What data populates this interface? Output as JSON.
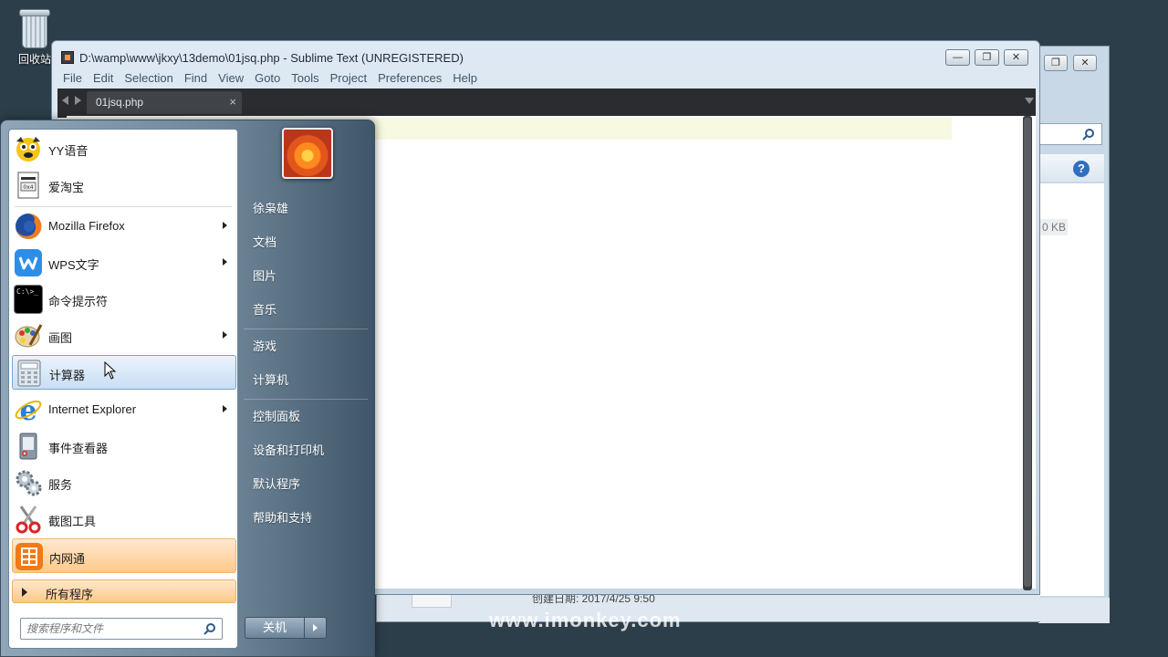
{
  "desktop": {
    "recycle_bin_label": "回收站"
  },
  "explorer": {
    "size_text": "0 KB",
    "created_text": "创建日期: 2017/4/25 9:50",
    "minimize": "▭",
    "close": "✕",
    "help": "?"
  },
  "watermark": "www.imonkey.com",
  "sublime": {
    "title": "D:\\wamp\\www\\jkxy\\13demo\\01jsq.php - Sublime Text (UNREGISTERED)",
    "controls": {
      "minimize": "—",
      "maximize": "❐",
      "close": "✕"
    },
    "menu": [
      "File",
      "Edit",
      "Selection",
      "Find",
      "View",
      "Goto",
      "Tools",
      "Project",
      "Preferences",
      "Help"
    ],
    "tab": {
      "label": "01jsq.php",
      "close": "×"
    }
  },
  "start_menu": {
    "programs": [
      {
        "name": "YY语音",
        "icon": "yy-icon",
        "arrow": false
      },
      {
        "name": "爱淘宝",
        "icon": "aitaobao-icon",
        "arrow": false
      },
      {
        "name": "Mozilla Firefox",
        "icon": "firefox-icon",
        "arrow": true
      },
      {
        "name": "WPS文字",
        "icon": "wps-icon",
        "arrow": true
      },
      {
        "name": "命令提示符",
        "icon": "cmd-icon",
        "arrow": false
      },
      {
        "name": "画图",
        "icon": "paint-icon",
        "arrow": true
      },
      {
        "name": "计算器",
        "icon": "calculator-icon",
        "arrow": false
      },
      {
        "name": "Internet Explorer",
        "icon": "ie-icon",
        "arrow": true
      },
      {
        "name": "事件查看器",
        "icon": "event-viewer-icon",
        "arrow": false
      },
      {
        "name": "服务",
        "icon": "services-icon",
        "arrow": false
      },
      {
        "name": "截图工具",
        "icon": "snipping-tool-icon",
        "arrow": false
      },
      {
        "name": "内网通",
        "icon": "neiwangtong-icon",
        "arrow": false
      }
    ],
    "all_programs": "所有程序",
    "search_placeholder": "搜索程序和文件",
    "right_links": [
      "徐枭雄",
      "文档",
      "图片",
      "音乐",
      "游戏",
      "计算机",
      "控制面板",
      "设备和打印机",
      "默认程序",
      "帮助和支持"
    ],
    "shutdown": "关机",
    "cmd_icon_text": "C:\\>_"
  },
  "colors": {
    "desktop_bg": "#2c3e4a",
    "hover_blue": "#c9def5",
    "highlight_orange": "#ffc98a"
  }
}
